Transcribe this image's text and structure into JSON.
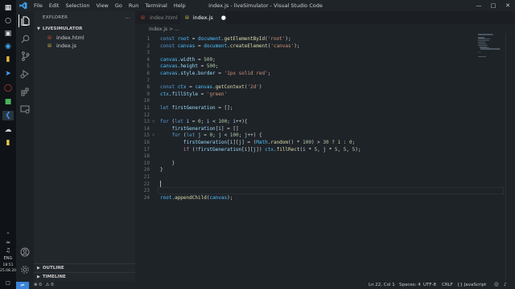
{
  "window": {
    "title": "index.js - liveSimulator - Visual Studio Code",
    "menu": [
      "File",
      "Edit",
      "Selection",
      "View",
      "Go",
      "Run",
      "Terminal",
      "Help"
    ]
  },
  "taskbar": {
    "time": "18:51",
    "date": "25.08.2022",
    "lang": "ENG"
  },
  "sidebar": {
    "title": "EXPLORER",
    "more": "...",
    "folder": "LIVESIMULATOR",
    "files": [
      "index.html",
      "index.js"
    ],
    "sections": [
      "OUTLINE",
      "TIMELINE"
    ]
  },
  "tabs": [
    {
      "label": "index.html",
      "active": false
    },
    {
      "label": "index.js",
      "active": true
    }
  ],
  "breadcrumb": "index.js > ...",
  "editor": {
    "lines": [
      {
        "n": "1",
        "text": "const root = document.getElementById('root');"
      },
      {
        "n": "2",
        "text": "const canvas = document.createElement('canvas');"
      },
      {
        "n": "3",
        "text": ""
      },
      {
        "n": "4",
        "text": "canvas.width = 500;"
      },
      {
        "n": "5",
        "text": "canvas.height = 500;"
      },
      {
        "n": "6",
        "text": "canvas.style.border = '1px solid red';"
      },
      {
        "n": "7",
        "text": ""
      },
      {
        "n": "8",
        "text": "const ctx = canvas.getContext('2d')"
      },
      {
        "n": "9",
        "text": "ctx.fillStyle = 'green'"
      },
      {
        "n": "10",
        "text": ""
      },
      {
        "n": "11",
        "text": "let firstGeneration = [];"
      },
      {
        "n": "12",
        "text": ""
      },
      {
        "n": "13",
        "text": "for (let i = 0; i < 100; i++){"
      },
      {
        "n": "14",
        "text": "    firstGeneration[i] = []"
      },
      {
        "n": "15",
        "text": "    for (let j = 0; j < 100; j++) {"
      },
      {
        "n": "16",
        "text": "        firstGeneration[i][j] = (Math.random() * 100) > 30 ? 1 : 0;"
      },
      {
        "n": "17",
        "text": "        if (!firstGeneration[i][j]) ctx.fillRect(i * 5, j * 5, 5, 5);"
      },
      {
        "n": "18",
        "text": ""
      },
      {
        "n": "19",
        "text": "    }"
      },
      {
        "n": "20",
        "text": "}"
      },
      {
        "n": "21",
        "text": ""
      },
      {
        "n": "22",
        "text": ""
      },
      {
        "n": "23",
        "text": ""
      },
      {
        "n": "24",
        "text": "root.appendChild(canvas);"
      }
    ]
  },
  "statusbar": {
    "errors": "0",
    "warnings": "0",
    "position": "Ln 22, Col 1",
    "spaces": "Spaces: 4",
    "encoding": "UTF-8",
    "eol": "CRLF",
    "language": "{} JavaScript"
  }
}
